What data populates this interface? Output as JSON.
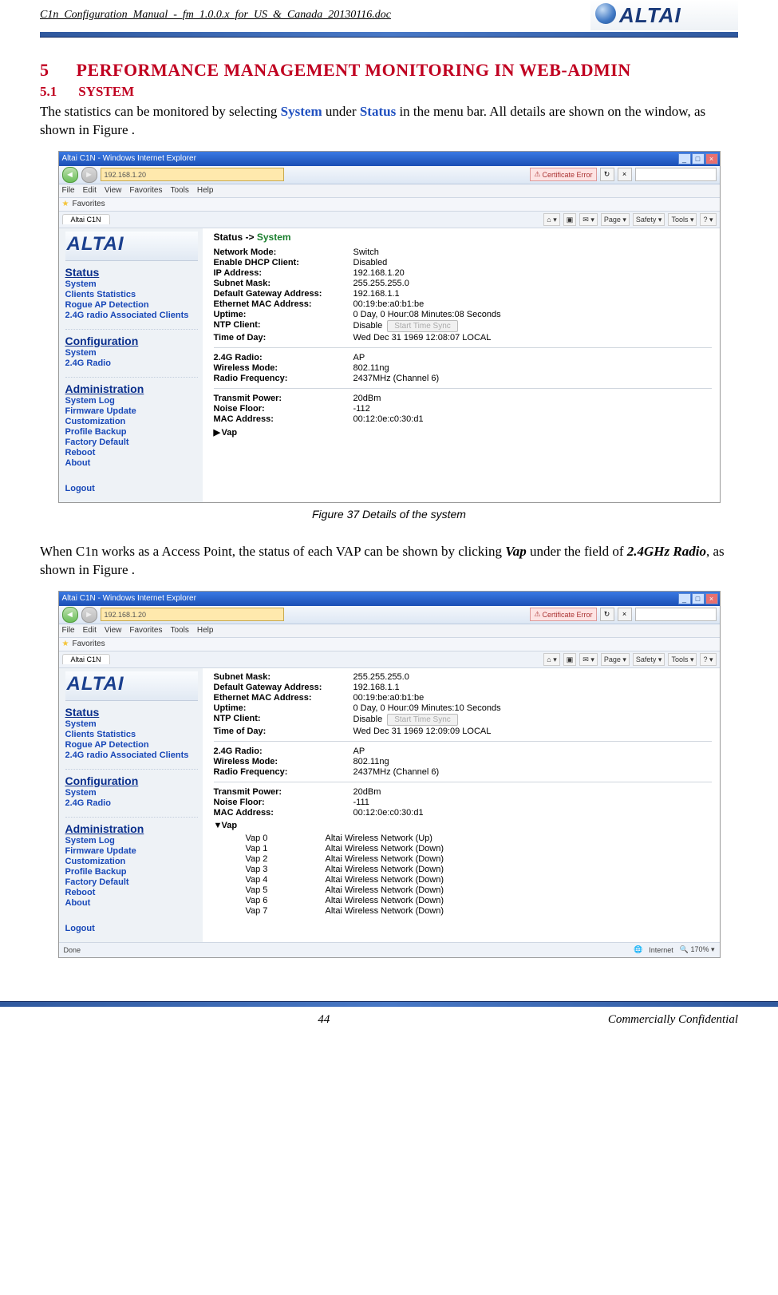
{
  "header": {
    "doc_name": "C1n_Configuration_Manual_-_fm_1.0.0.x_for_US_&_Canada_20130116.doc",
    "logo_text": "ALTAI"
  },
  "section": {
    "num": "5",
    "title": "PERFORMANCE MANAGEMENT MONITORING IN WEB-ADMIN",
    "sub_num": "5.1",
    "sub_title": "SYSTEM"
  },
  "para1_a": "The statistics can be monitored by selecting ",
  "para1_b": "System",
  "para1_c": " under ",
  "para1_d": "Status",
  "para1_e": " in the menu bar. All details are shown on the window, as shown in Figure .",
  "caption1": "Figure 37    Details of the system",
  "para2_a": "When C1n works as a Access Point, the status of each VAP can be shown by clicking ",
  "para2_b": "Vap",
  "para2_c": " under the field of ",
  "para2_d": "2.4GHz Radio",
  "para2_e": ", as shown in Figure .",
  "ie": {
    "title": "Altai C1N - Windows Internet Explorer",
    "address": "192.168.1.20",
    "cert_error": "Certificate Error",
    "menu": [
      "File",
      "Edit",
      "View",
      "Favorites",
      "Tools",
      "Help"
    ],
    "favorites": "Favorites",
    "tab": "Altai C1N",
    "tools_row": [
      "Page ▾",
      "Safety ▾",
      "Tools ▾"
    ],
    "status_left": "Done",
    "status_right_zone": "Internet",
    "status_zoom": "170%"
  },
  "nav": {
    "logo": "ALTAI",
    "groups": [
      {
        "header": "Status",
        "items": [
          "System",
          "Clients Statistics",
          "Rogue AP Detection",
          "2.4G radio Associated Clients"
        ]
      },
      {
        "header": "Configuration",
        "items": [
          "System",
          "2.4G Radio"
        ]
      },
      {
        "header": "Administration",
        "items": [
          "System Log",
          "Firmware Update",
          "Customization",
          "Profile Backup",
          "Factory Default",
          "Reboot",
          "About"
        ]
      }
    ],
    "logout": "Logout"
  },
  "shot1": {
    "breadcrumb_a": "Status -> ",
    "breadcrumb_b": "System",
    "rows_top": [
      {
        "k": "Network Mode:",
        "v": "Switch"
      },
      {
        "k": "Enable DHCP Client:",
        "v": "Disabled"
      },
      {
        "k": "IP Address:",
        "v": "192.168.1.20"
      },
      {
        "k": "Subnet Mask:",
        "v": "255.255.255.0"
      },
      {
        "k": "Default Gateway Address:",
        "v": "192.168.1.1"
      },
      {
        "k": "Ethernet MAC Address:",
        "v": "00:19:be:a0:b1:be"
      },
      {
        "k": "Uptime:",
        "v": "0 Day, 0 Hour:08 Minutes:08 Seconds"
      }
    ],
    "ntp_k": "NTP Client:",
    "ntp_v": "Disable",
    "sync_btn": "Start Time Sync",
    "tod": {
      "k": "Time of Day:",
      "v": "Wed Dec 31 1969 12:08:07 LOCAL"
    },
    "rows_radio": [
      {
        "k": "2.4G Radio:",
        "v": "AP"
      },
      {
        "k": "Wireless Mode:",
        "v": "802.11ng"
      },
      {
        "k": "Radio Frequency:",
        "v": "2437MHz (Channel 6)"
      }
    ],
    "rows_radio2": [
      {
        "k": "Transmit Power:",
        "v": "20dBm"
      },
      {
        "k": "Noise Floor:",
        "v": "-112"
      },
      {
        "k": "MAC Address:",
        "v": "00:12:0e:c0:30:d1"
      }
    ],
    "vap_label": "Vap",
    "vap_arrow": "▶"
  },
  "shot2": {
    "rows_top": [
      {
        "k": "Subnet Mask:",
        "v": "255.255.255.0"
      },
      {
        "k": "Default Gateway Address:",
        "v": "192.168.1.1"
      },
      {
        "k": "Ethernet MAC Address:",
        "v": "00:19:be:a0:b1:be"
      },
      {
        "k": "Uptime:",
        "v": "0 Day, 0 Hour:09 Minutes:10 Seconds"
      }
    ],
    "ntp_k": "NTP Client:",
    "ntp_v": "Disable",
    "sync_btn": "Start Time Sync",
    "tod": {
      "k": "Time of Day:",
      "v": "Wed Dec 31 1969 12:09:09 LOCAL"
    },
    "rows_radio": [
      {
        "k": "2.4G Radio:",
        "v": "AP"
      },
      {
        "k": "Wireless Mode:",
        "v": "802.11ng"
      },
      {
        "k": "Radio Frequency:",
        "v": "2437MHz (Channel 6)"
      }
    ],
    "rows_radio2": [
      {
        "k": "Transmit Power:",
        "v": "20dBm"
      },
      {
        "k": "Noise Floor:",
        "v": "-111"
      },
      {
        "k": "MAC Address:",
        "v": "00:12:0e:c0:30:d1"
      }
    ],
    "vap_label": "Vap",
    "vap_arrow": "▼",
    "vaps": [
      {
        "l": "Vap 0",
        "r": "Altai Wireless Network (Up)"
      },
      {
        "l": "Vap 1",
        "r": "Altai Wireless Network (Down)"
      },
      {
        "l": "Vap 2",
        "r": "Altai Wireless Network (Down)"
      },
      {
        "l": "Vap 3",
        "r": "Altai Wireless Network (Down)"
      },
      {
        "l": "Vap 4",
        "r": "Altai Wireless Network (Down)"
      },
      {
        "l": "Vap 5",
        "r": "Altai Wireless Network (Down)"
      },
      {
        "l": "Vap 6",
        "r": "Altai Wireless Network (Down)"
      },
      {
        "l": "Vap 7",
        "r": "Altai Wireless Network (Down)"
      }
    ]
  },
  "footer": {
    "page": "44",
    "conf": "Commercially Confidential"
  }
}
